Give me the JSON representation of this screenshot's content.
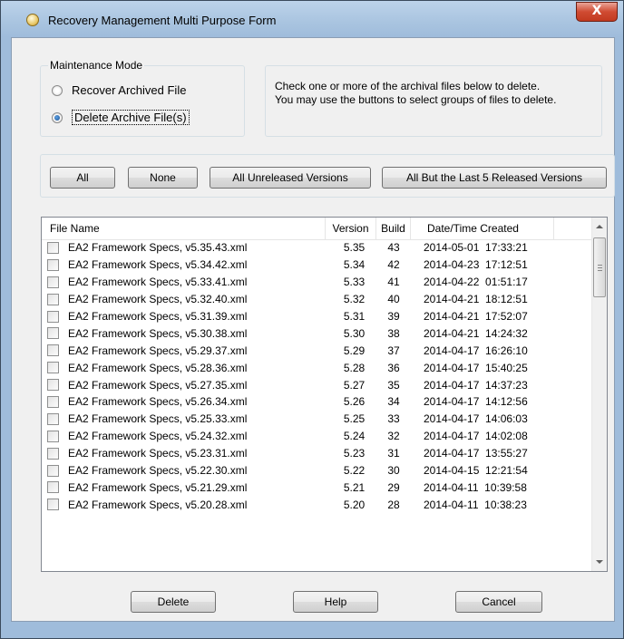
{
  "window": {
    "title": "Recovery Management Multi Purpose Form",
    "close_glyph": "X"
  },
  "maintenance": {
    "legend": "Maintenance Mode",
    "options": [
      {
        "label": "Recover Archived File",
        "selected": false
      },
      {
        "label": "Delete Archive File(s)",
        "selected": true
      }
    ]
  },
  "instructions": {
    "line1": "Check one or more of the archival files below to delete.",
    "line2": "You may use the buttons to select groups of files to delete."
  },
  "selection_buttons": {
    "all": "All",
    "none": "None",
    "unreleased": "All Unreleased Versions",
    "but_last5": "All But the Last 5 Released Versions"
  },
  "file_list": {
    "headers": {
      "name": "File Name",
      "version": "Version",
      "build": "Build",
      "date": "Date/Time Created"
    },
    "rows": [
      {
        "name": "EA2 Framework Specs, v5.35.43.xml",
        "version": "5.35",
        "build": "43",
        "date": "2014-05-01  17:33:21",
        "checked": false
      },
      {
        "name": "EA2 Framework Specs, v5.34.42.xml",
        "version": "5.34",
        "build": "42",
        "date": "2014-04-23  17:12:51",
        "checked": false
      },
      {
        "name": "EA2 Framework Specs, v5.33.41.xml",
        "version": "5.33",
        "build": "41",
        "date": "2014-04-22  01:51:17",
        "checked": false
      },
      {
        "name": "EA2 Framework Specs, v5.32.40.xml",
        "version": "5.32",
        "build": "40",
        "date": "2014-04-21  18:12:51",
        "checked": false
      },
      {
        "name": "EA2 Framework Specs, v5.31.39.xml",
        "version": "5.31",
        "build": "39",
        "date": "2014-04-21  17:52:07",
        "checked": false
      },
      {
        "name": "EA2 Framework Specs, v5.30.38.xml",
        "version": "5.30",
        "build": "38",
        "date": "2014-04-21  14:24:32",
        "checked": false
      },
      {
        "name": "EA2 Framework Specs, v5.29.37.xml",
        "version": "5.29",
        "build": "37",
        "date": "2014-04-17  16:26:10",
        "checked": false
      },
      {
        "name": "EA2 Framework Specs, v5.28.36.xml",
        "version": "5.28",
        "build": "36",
        "date": "2014-04-17  15:40:25",
        "checked": false
      },
      {
        "name": "EA2 Framework Specs, v5.27.35.xml",
        "version": "5.27",
        "build": "35",
        "date": "2014-04-17  14:37:23",
        "checked": false
      },
      {
        "name": "EA2 Framework Specs, v5.26.34.xml",
        "version": "5.26",
        "build": "34",
        "date": "2014-04-17  14:12:56",
        "checked": false
      },
      {
        "name": "EA2 Framework Specs, v5.25.33.xml",
        "version": "5.25",
        "build": "33",
        "date": "2014-04-17  14:06:03",
        "checked": false
      },
      {
        "name": "EA2 Framework Specs, v5.24.32.xml",
        "version": "5.24",
        "build": "32",
        "date": "2014-04-17  14:02:08",
        "checked": false
      },
      {
        "name": "EA2 Framework Specs, v5.23.31.xml",
        "version": "5.23",
        "build": "31",
        "date": "2014-04-17  13:55:27",
        "checked": false
      },
      {
        "name": "EA2 Framework Specs, v5.22.30.xml",
        "version": "5.22",
        "build": "30",
        "date": "2014-04-15  12:21:54",
        "checked": false
      },
      {
        "name": "EA2 Framework Specs, v5.21.29.xml",
        "version": "5.21",
        "build": "29",
        "date": "2014-04-11  10:39:58",
        "checked": false
      },
      {
        "name": "EA2 Framework Specs, v5.20.28.xml",
        "version": "5.20",
        "build": "28",
        "date": "2014-04-11  10:38:23",
        "checked": false
      }
    ]
  },
  "footer_buttons": {
    "delete": "Delete",
    "help": "Help",
    "cancel": "Cancel"
  }
}
